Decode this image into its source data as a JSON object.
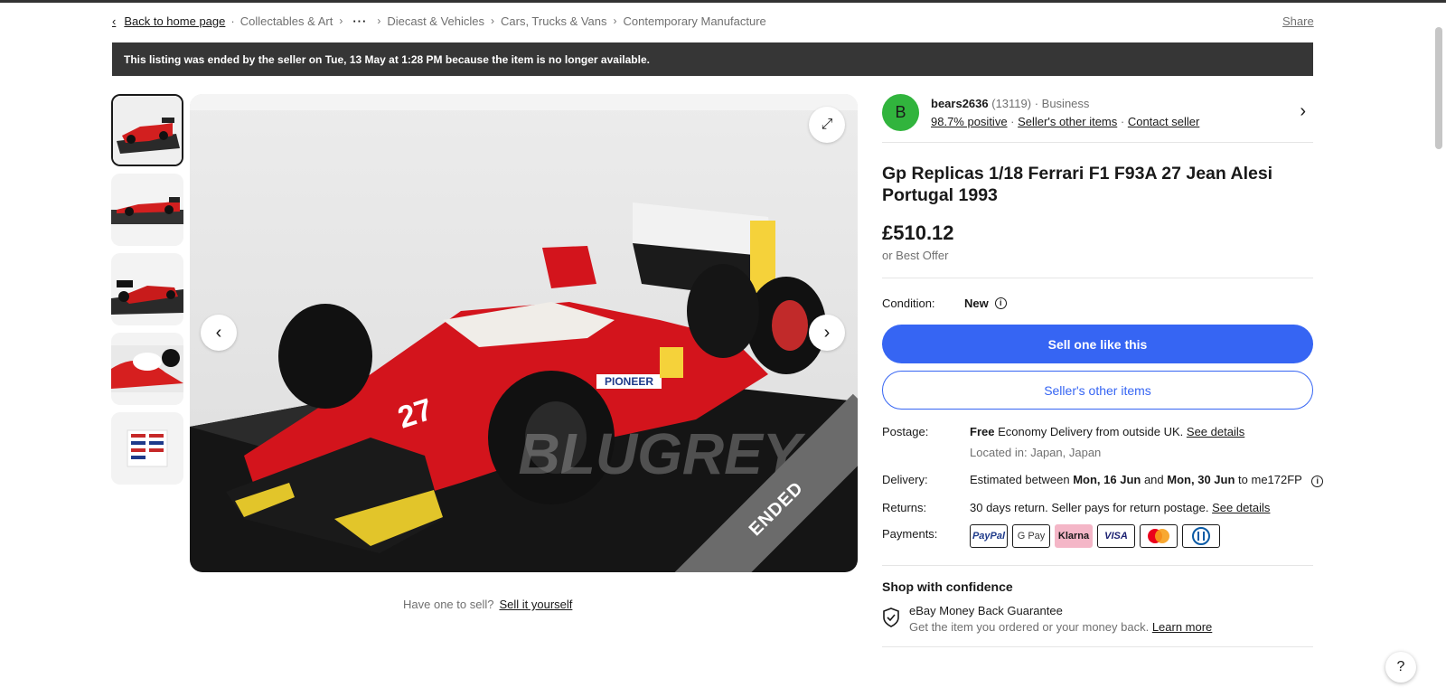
{
  "breadcrumb": {
    "back_label": "Back to home page",
    "items": [
      "Collectables & Art",
      "Diecast & Vehicles",
      "Cars, Trucks & Vans",
      "Contemporary Manufacture"
    ],
    "more_label": "···"
  },
  "share_label": "Share",
  "banner_text": "This listing was ended by the seller on Tue, 13 May at 1:28 PM because the item is no longer available.",
  "gallery": {
    "ribbon_text": "ENDED",
    "watermark": "BLUGREY"
  },
  "sell_prompt": {
    "text": "Have one to sell?",
    "link": "Sell it yourself"
  },
  "seller": {
    "avatar_letter": "B",
    "name": "bears2636",
    "feedback_count": "(13119)",
    "type": "· Business",
    "positive": "98.7% positive",
    "other_items": "Seller's other items",
    "contact": "Contact seller"
  },
  "item": {
    "title": "Gp Replicas 1/18 Ferrari F1 F93A 27 Jean Alesi Portugal 1993",
    "price": "£510.12",
    "best_offer": "or Best Offer",
    "condition_label": "Condition:",
    "condition_value": "New"
  },
  "buttons": {
    "primary": "Sell one like this",
    "secondary": "Seller's other items"
  },
  "postage": {
    "label": "Postage:",
    "free": "Free",
    "text": "Economy Delivery from outside UK.",
    "details": "See details",
    "location": "Located in: Japan, Japan"
  },
  "delivery": {
    "label": "Delivery:",
    "prefix": "Estimated between",
    "date1": "Mon, 16 Jun",
    "and": "and",
    "date2": "Mon, 30 Jun",
    "suffix": "to me172FP"
  },
  "returns": {
    "label": "Returns:",
    "text": "30 days return. Seller pays for return postage.",
    "details": "See details"
  },
  "payments": {
    "label": "Payments:",
    "methods": [
      "PayPal",
      "G Pay",
      "Klarna",
      "VISA",
      "",
      ""
    ]
  },
  "confidence": {
    "title": "Shop with confidence",
    "guarantee_title": "eBay Money Back Guarantee",
    "guarantee_text": "Get the item you ordered or your money back.",
    "learn_more": "Learn more"
  },
  "help_label": "?"
}
